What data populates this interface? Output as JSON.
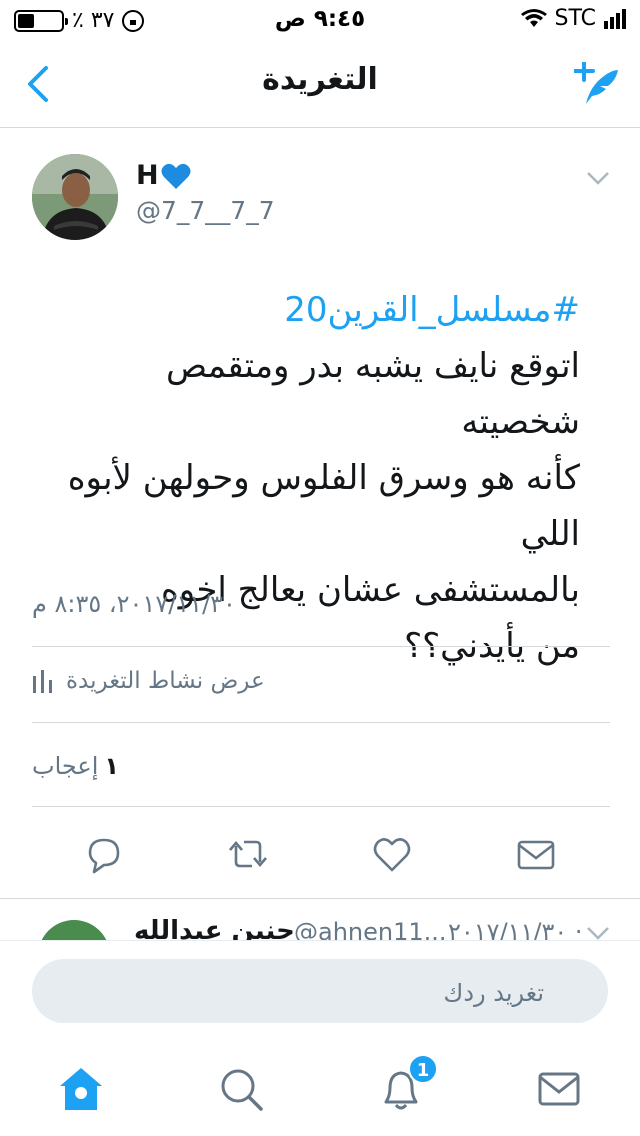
{
  "status_bar": {
    "battery_percent": "٪ ٣٧",
    "battery_level": 0.37,
    "time": "٩:٤٥ ص",
    "carrier": "STC"
  },
  "nav": {
    "title": "التغريدة",
    "back_icon": "chevron-left-icon",
    "compose_icon": "compose-tweet-icon"
  },
  "tweet": {
    "author_name": "H",
    "author_emoji": "blue-heart",
    "handle": "@7_7__7_7",
    "hashtag": "#مسلسل_القرين20",
    "lines": [
      "اتوقع نايف يشبه بدر ومتقمص شخصيته",
      "كأنه هو وسرق الفلوس وحولهن لأبوه اللي",
      "بالمستشفى عشان يعالج اخوه",
      "من يأيدني؟؟"
    ],
    "timestamp": "٢٠١٧/١١/٣٠، ٨:٣٥ م",
    "activity_label": "عرض نشاط التغريدة",
    "likes_count": "١",
    "likes_label": "إعجاب"
  },
  "actions": {
    "reply": "reply-icon",
    "retweet": "retweet-icon",
    "like": "heart-icon",
    "message": "mail-icon"
  },
  "reply_preview": {
    "name": "حنين عبدالله",
    "handle": "@ahnen11...",
    "date": "٢٠١٧/١١/٣٠ ·"
  },
  "compose": {
    "placeholder": "تغريد ردك"
  },
  "tab_bar": {
    "notifications_badge": "1"
  },
  "colors": {
    "accent": "#1da1f2",
    "secondary_text": "#657786",
    "divider": "#d6d9db"
  }
}
